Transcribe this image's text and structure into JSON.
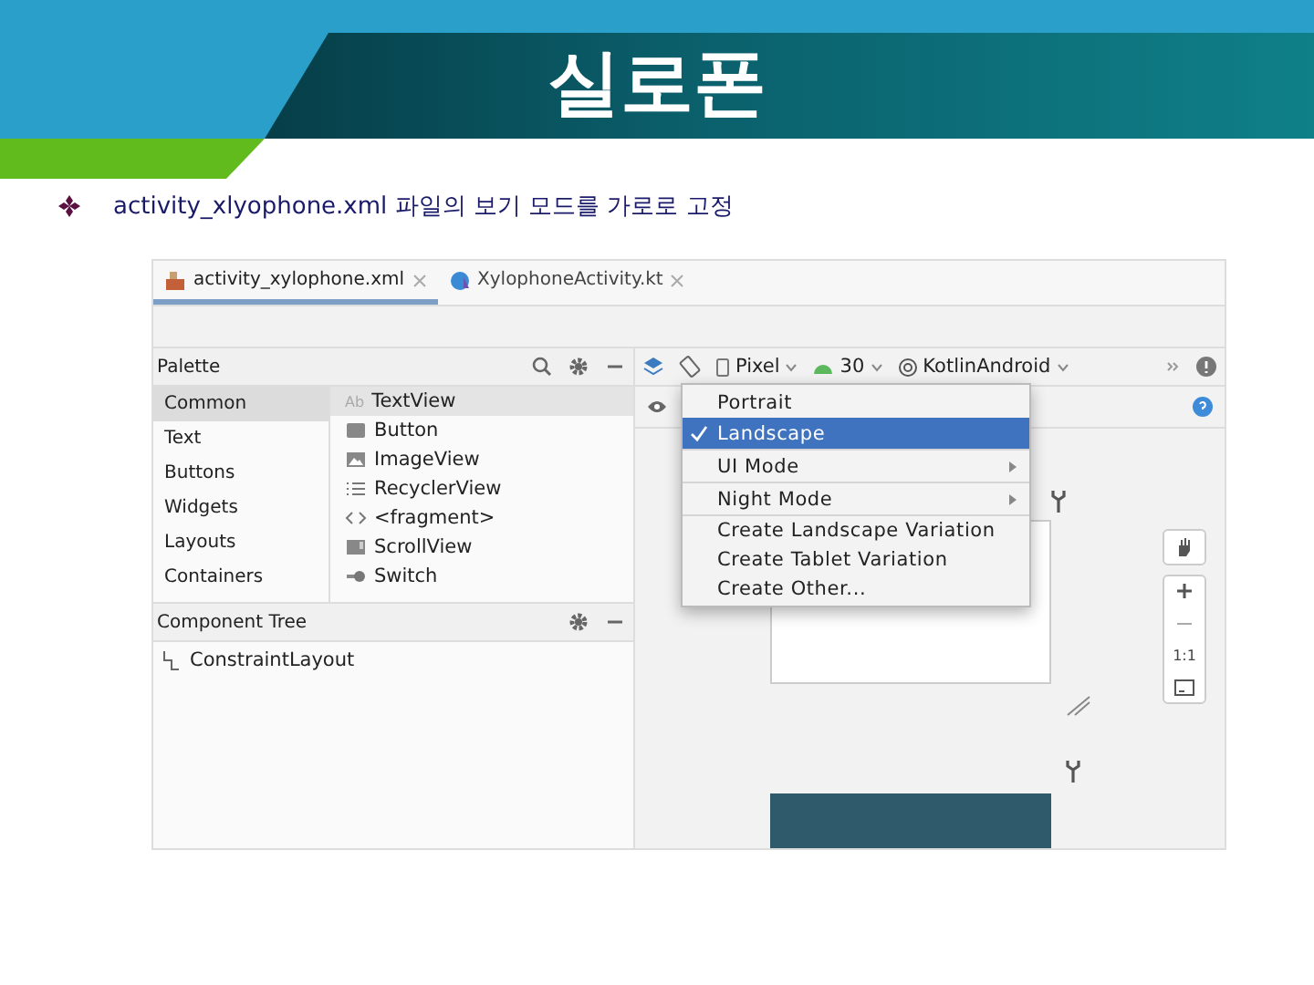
{
  "slide": {
    "title": "실로폰",
    "bullet": "activity_xlyophone.xml 파일의 보기 모드를 가로로 고정"
  },
  "ide": {
    "tabs": [
      {
        "label": "activity_xylophone.xml",
        "selected": true
      },
      {
        "label": "XylophoneActivity.kt",
        "selected": false
      }
    ],
    "palette": {
      "title": "Palette",
      "categories": [
        {
          "label": "Common",
          "selected": true
        },
        {
          "label": "Text",
          "selected": false
        },
        {
          "label": "Buttons",
          "selected": false
        },
        {
          "label": "Widgets",
          "selected": false
        },
        {
          "label": "Layouts",
          "selected": false
        },
        {
          "label": "Containers",
          "selected": false
        }
      ],
      "widgets": [
        {
          "label": "TextView",
          "selected": true,
          "glyph": "Ab"
        },
        {
          "label": "Button",
          "selected": false
        },
        {
          "label": "ImageView",
          "selected": false
        },
        {
          "label": "RecyclerView",
          "selected": false
        },
        {
          "label": "<fragment>",
          "selected": false
        },
        {
          "label": "ScrollView",
          "selected": false
        },
        {
          "label": "Switch",
          "selected": false
        }
      ]
    },
    "component_tree": {
      "title": "Component Tree",
      "items": [
        "ConstraintLayout"
      ]
    },
    "toolbar": {
      "device": "Pixel",
      "api": "30",
      "theme": "KotlinAndroid"
    },
    "zoom_controls": {
      "actual_size": "1:1"
    },
    "orientation_menu": [
      {
        "kind": "option",
        "label": "Portrait",
        "checked": false,
        "selected": false
      },
      {
        "kind": "option",
        "label": "Landscape",
        "checked": true,
        "selected": true
      },
      {
        "kind": "submenu",
        "label": "UI Mode",
        "checked": false,
        "selected": false
      },
      {
        "kind": "submenu",
        "label": "Night Mode",
        "checked": false,
        "selected": false
      },
      {
        "kind": "action",
        "label": "Create Landscape Variation",
        "checked": false,
        "selected": false
      },
      {
        "kind": "action",
        "label": "Create Tablet Variation",
        "checked": false,
        "selected": false
      },
      {
        "kind": "action",
        "label": "Create Other...",
        "checked": false,
        "selected": false
      }
    ]
  }
}
